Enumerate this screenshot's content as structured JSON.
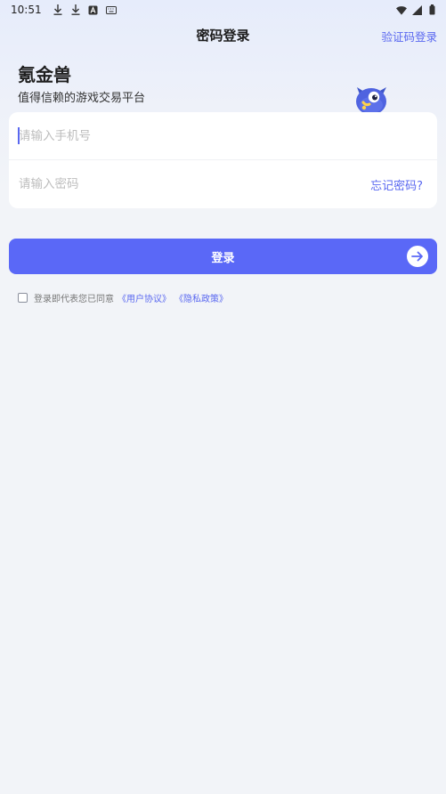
{
  "status_bar": {
    "time": "10:51",
    "icons": [
      "download-icon",
      "download-icon",
      "font-app-icon",
      "keyboard-icon"
    ],
    "right_icons": [
      "wifi-icon",
      "cell-signal-icon",
      "battery-icon"
    ]
  },
  "header": {
    "title": "密码登录",
    "switch_label": "验证码登录"
  },
  "brand": {
    "title": "氪金兽",
    "subtitle": "值得信赖的游戏交易平台"
  },
  "form": {
    "phone_placeholder": "请输入手机号",
    "password_placeholder": "请输入密码",
    "forgot_label": "忘记密码?"
  },
  "login_button": {
    "label": "登录"
  },
  "agreement": {
    "prefix": "登录即代表您已同意",
    "user_agreement": "《用户协议》",
    "privacy_policy": "《隐私政策》",
    "checked": false
  },
  "colors": {
    "accent": "#5a68f7",
    "link": "#5a68f0",
    "background": "#f2f4f8"
  }
}
